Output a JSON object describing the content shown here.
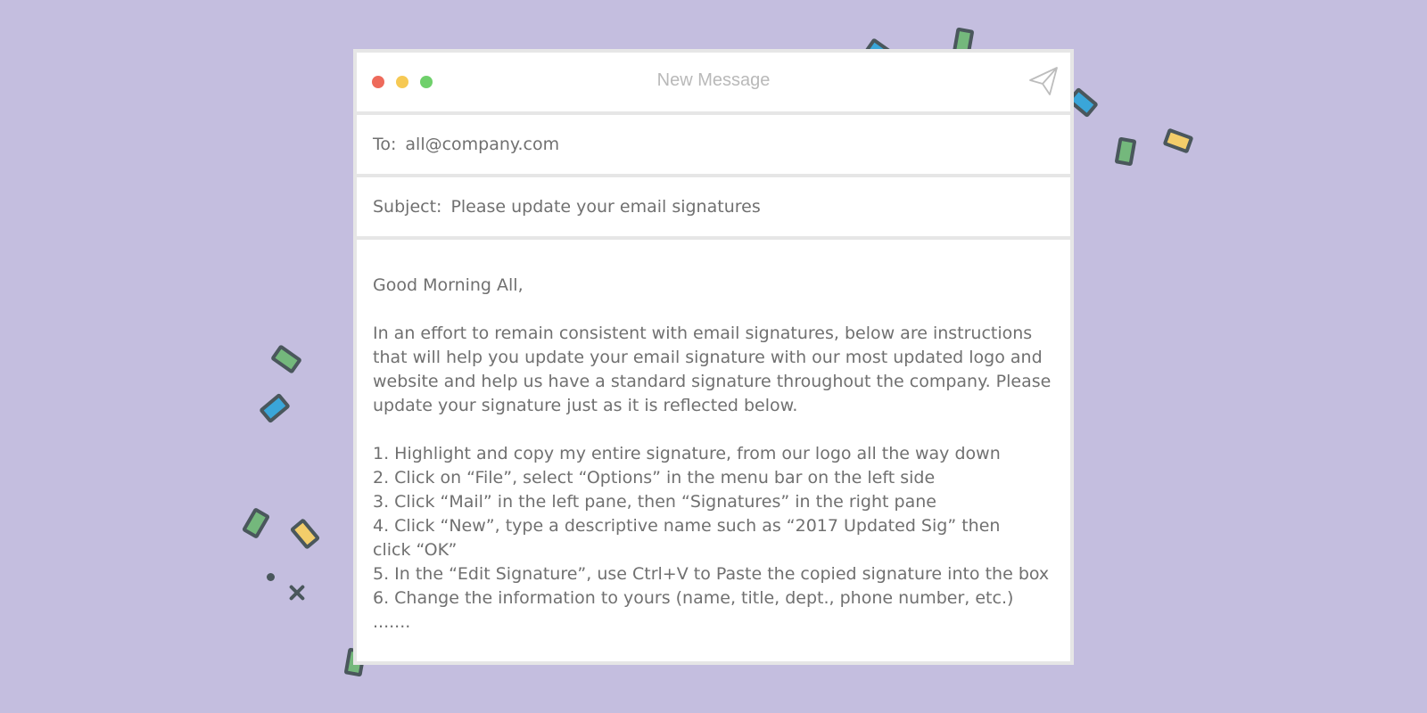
{
  "window": {
    "title": "New Message",
    "send_icon": "paper-plane-icon"
  },
  "to": {
    "label": "To:",
    "value": "all@company.com"
  },
  "subject": {
    "label": "Subject:",
    "value": "Please update your email signatures"
  },
  "body": {
    "greeting": "Good Morning All,",
    "paragraph": "In an effort to remain consistent with email signatures, below are instructions that will help you update your email signature with our most updated logo and website and help us have a standard signature throughout the company. Please update your signature just as it is reflected below.",
    "steps": [
      "1. Highlight and copy my entire signature, from our logo all the way down",
      "2. Click on “File”, select “Options” in the menu bar on the left side",
      "3. Click “Mail” in the left pane, then “Signatures” in the right pane",
      "4. Click “New”, type a descriptive name such as “2017 Updated Sig” then click “OK”",
      "5. In the “Edit Signature”, use Ctrl+V to Paste the copied signature into the box",
      "6. Change the information to yours (name, title, dept., phone number, etc.)"
    ],
    "ellipsis": "......."
  },
  "colors": {
    "background": "#c4bedf",
    "traffic_red": "#ee6a5b",
    "traffic_yellow": "#f6c954",
    "traffic_green": "#6fd06b"
  }
}
